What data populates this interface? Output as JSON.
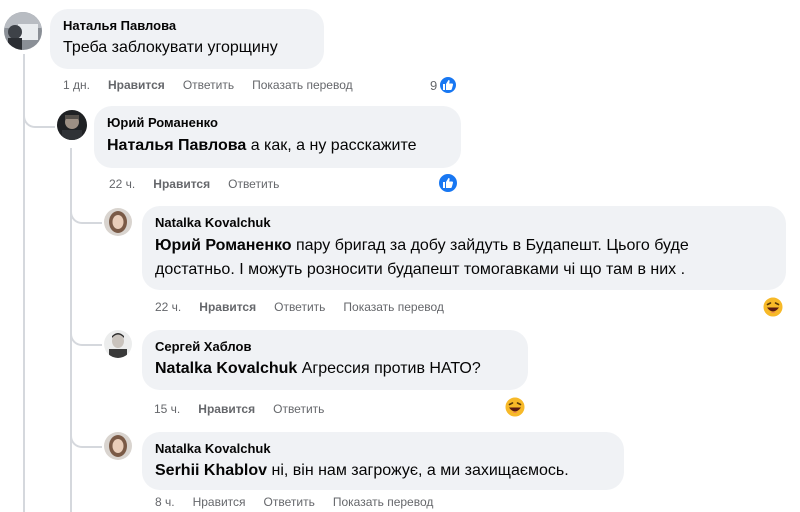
{
  "comments": [
    {
      "author": "Наталья Павлова",
      "text": "Треба заблокувати угорщину",
      "time": "1 дн.",
      "like_label": "Нравится",
      "reply_label": "Ответить",
      "translate_label": "Показать перевод",
      "reaction": "like",
      "reaction_count": "9"
    },
    {
      "author": "Юрий Романенко",
      "mention": "Наталья Павлова",
      "text": " а как, а ну расскажите",
      "time": "22 ч.",
      "like_label": "Нравится",
      "reply_label": "Ответить",
      "reaction": "like"
    },
    {
      "author": "Natalka Kovalchuk",
      "mention": "Юрий Романенко",
      "text_line1": " пару бригад за добу зайдуть в Будапешт. Цього буде",
      "text_line2": "достатньо. І можуть розносити будапешт томогавками чі що там в них .",
      "time": "22 ч.",
      "like_label": "Нравится",
      "reply_label": "Ответить",
      "translate_label": "Показать перевод",
      "reaction": "haha"
    },
    {
      "author": "Сергей Хаблов",
      "mention": "Natalka Kovalchuk",
      "text": " Агрессия против НАТО?",
      "time": "15 ч.",
      "like_label": "Нравится",
      "reply_label": "Ответить",
      "reaction": "haha"
    },
    {
      "author": "Natalka Kovalchuk",
      "mention": "Serhii Khablov",
      "text": " ні, він нам загрожує, а ми захищаємось.",
      "time": "8 ч.",
      "like_label": "Нравится",
      "reply_label": "Ответить",
      "translate_label": "Показать перевод"
    }
  ],
  "colors": {
    "bubble": "#f0f2f5",
    "meta_text": "#65676b",
    "like_blue": "#1877f2",
    "thread_line": "#d5d8dd"
  }
}
